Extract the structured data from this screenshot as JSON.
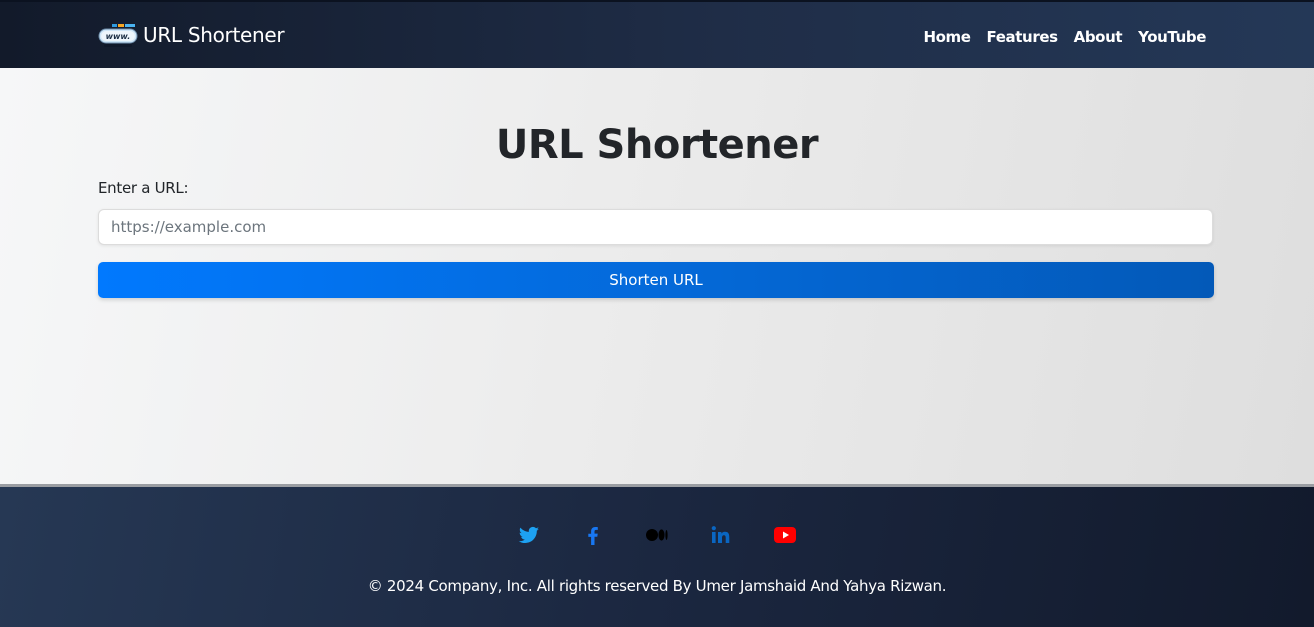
{
  "nav": {
    "brand": "URL Shortener",
    "logo_text": "www.",
    "links": [
      "Home",
      "Features",
      "About",
      "YouTube"
    ]
  },
  "main": {
    "title": "URL Shortener",
    "url_label": "Enter a URL:",
    "url_placeholder": "https://example.com",
    "url_value": "",
    "button_label": "Shorten URL"
  },
  "footer": {
    "social": [
      {
        "name": "twitter-icon",
        "color": "#1da1f2"
      },
      {
        "name": "facebook-icon",
        "color": "#1877f2"
      },
      {
        "name": "medium-icon",
        "color": "#000000"
      },
      {
        "name": "linkedin-icon",
        "color": "#0a66c2"
      },
      {
        "name": "youtube-icon",
        "color": "#ff0000"
      }
    ],
    "copyright": "© 2024 Company, Inc. All rights reserved By Umer Jamshaid And Yahya Rizwan."
  },
  "colors": {
    "accent": "#007bff",
    "navbar": "#1f2d47",
    "footer": "#1b2740"
  }
}
